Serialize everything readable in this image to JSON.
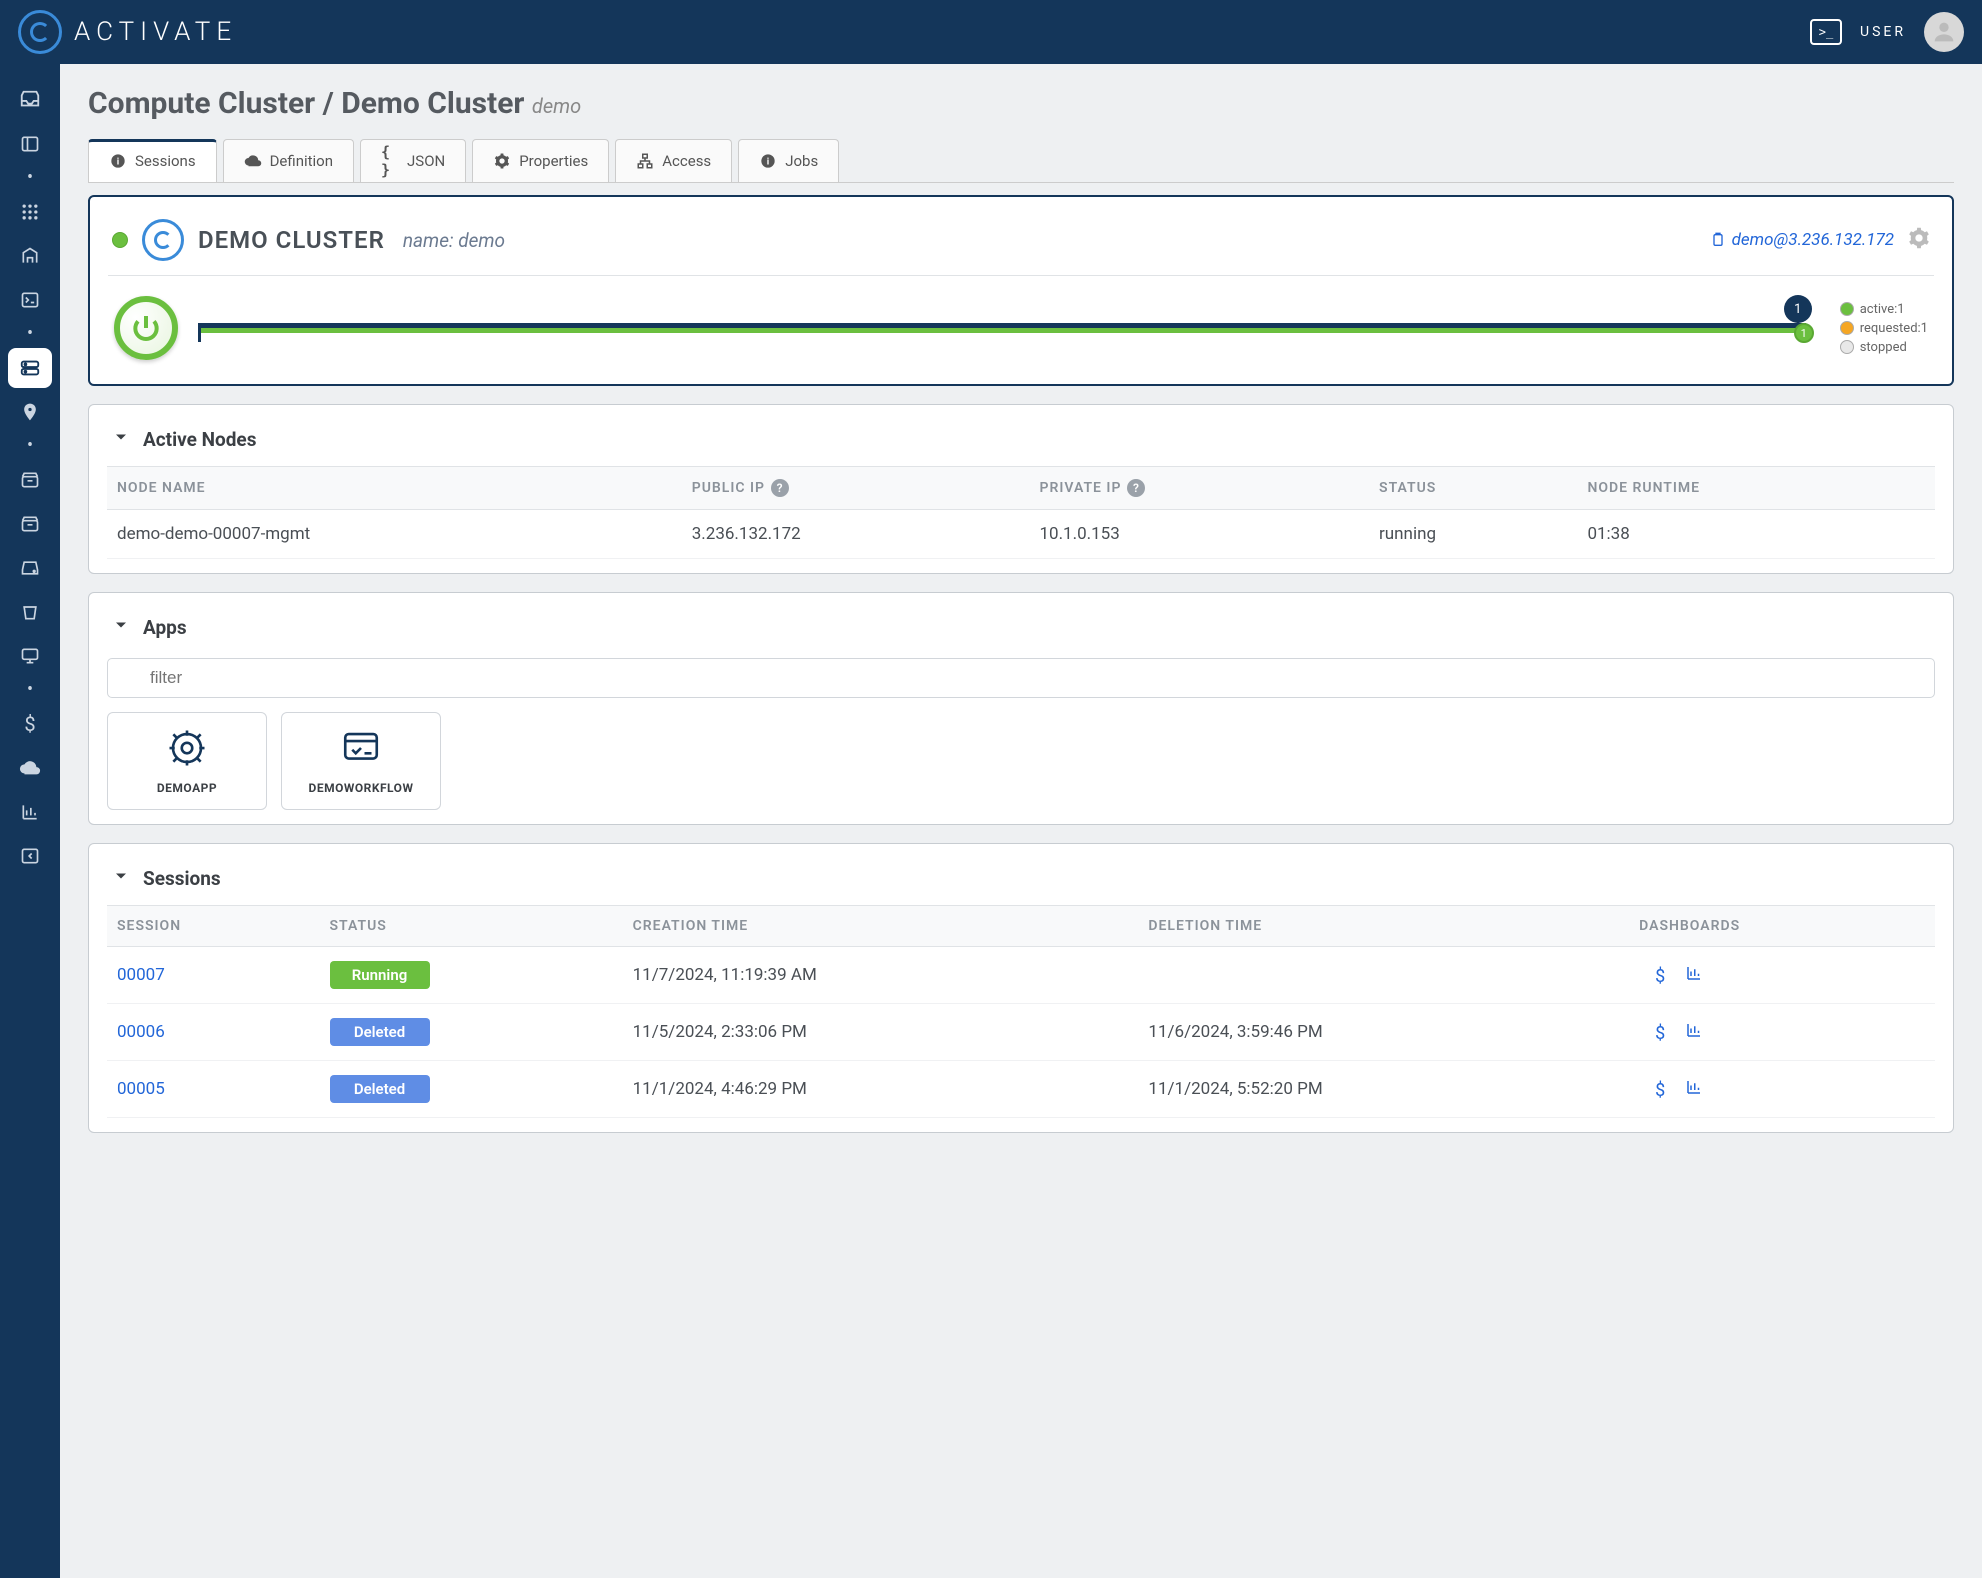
{
  "brand": "ACTIVATE",
  "user_label": "USER",
  "page": {
    "breadcrumb_main": "Compute Cluster / Demo Cluster",
    "breadcrumb_sub": "demo"
  },
  "tabs": [
    {
      "label": "Sessions"
    },
    {
      "label": "Definition"
    },
    {
      "label": "JSON"
    },
    {
      "label": "Properties"
    },
    {
      "label": "Access"
    },
    {
      "label": "Jobs"
    }
  ],
  "cluster": {
    "title": "DEMO CLUSTER",
    "subtitle": "name: demo",
    "ssh_link": "demo@3.236.132.172",
    "marker_top": "1",
    "marker_bot": "1",
    "legend": {
      "active": "active:1",
      "requested": "requested:1",
      "stopped": "stopped"
    }
  },
  "nodes": {
    "section": "Active Nodes",
    "cols": {
      "name": "NODE NAME",
      "pub": "PUBLIC IP",
      "priv": "PRIVATE IP",
      "status": "STATUS",
      "runtime": "NODE RUNTIME"
    },
    "rows": [
      {
        "name": "demo-demo-00007-mgmt",
        "pub": "3.236.132.172",
        "priv": "10.1.0.153",
        "status": "running",
        "runtime": "01:38"
      }
    ]
  },
  "apps": {
    "section": "Apps",
    "filter_placeholder": "filter",
    "items": [
      {
        "label": "DEMOAPP"
      },
      {
        "label": "DEMOWORKFLOW"
      }
    ]
  },
  "sessions": {
    "section": "Sessions",
    "cols": {
      "id": "SESSION",
      "status": "STATUS",
      "created": "CREATION TIME",
      "deleted": "DELETION TIME",
      "dash": "DASHBOARDS"
    },
    "rows": [
      {
        "id": "00007",
        "status": "Running",
        "status_cls": "running",
        "created": "11/7/2024, 11:19:39 AM",
        "deleted": ""
      },
      {
        "id": "00006",
        "status": "Deleted",
        "status_cls": "deleted",
        "created": "11/5/2024, 2:33:06 PM",
        "deleted": "11/6/2024, 3:59:46 PM"
      },
      {
        "id": "00005",
        "status": "Deleted",
        "status_cls": "deleted",
        "created": "11/1/2024, 4:46:29 PM",
        "deleted": "11/1/2024, 5:52:20 PM"
      }
    ]
  },
  "colors": {
    "green": "#6bbf3f",
    "orange": "#f5a623",
    "gray": "#d8d8d8"
  }
}
